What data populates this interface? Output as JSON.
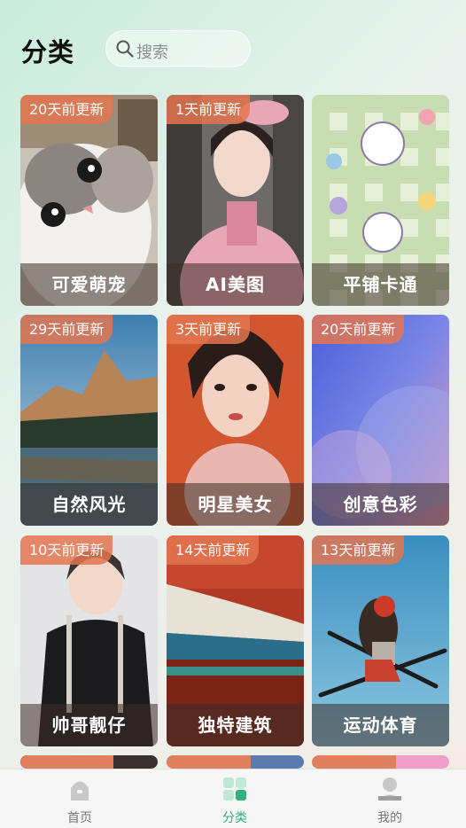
{
  "header": {
    "title": "分类",
    "search_placeholder": "搜索"
  },
  "categories": [
    {
      "name": "可爱萌宠",
      "updated": "20天前更新",
      "icon": "cat-photo"
    },
    {
      "name": "AI美图",
      "updated": "1天前更新",
      "icon": "ai-portrait-photo"
    },
    {
      "name": "平铺卡通",
      "updated": "",
      "icon": "cartoon-pattern"
    },
    {
      "name": "自然风光",
      "updated": "29天前更新",
      "icon": "mountain-lake-photo"
    },
    {
      "name": "明星美女",
      "updated": "3天前更新",
      "icon": "portrait-photo"
    },
    {
      "name": "创意色彩",
      "updated": "20天前更新",
      "icon": "gradient-art"
    },
    {
      "name": "帅哥靓仔",
      "updated": "10天前更新",
      "icon": "portrait-photo"
    },
    {
      "name": "独特建筑",
      "updated": "14天前更新",
      "icon": "palace-roof-photo"
    },
    {
      "name": "运动体育",
      "updated": "13天前更新",
      "icon": "skier-photo"
    },
    {
      "name": "",
      "updated": "",
      "icon": "partial-card"
    },
    {
      "name": "",
      "updated": "",
      "icon": "partial-card"
    },
    {
      "name": "",
      "updated": "",
      "icon": "partial-card"
    }
  ],
  "tabbar": {
    "items": [
      {
        "label": "首页",
        "icon": "home-icon",
        "active": false
      },
      {
        "label": "分类",
        "icon": "grid-icon",
        "active": true
      },
      {
        "label": "我的",
        "icon": "user-icon",
        "active": false
      }
    ]
  },
  "colors": {
    "accent": "#2fb27d",
    "badge": "#e47650"
  }
}
